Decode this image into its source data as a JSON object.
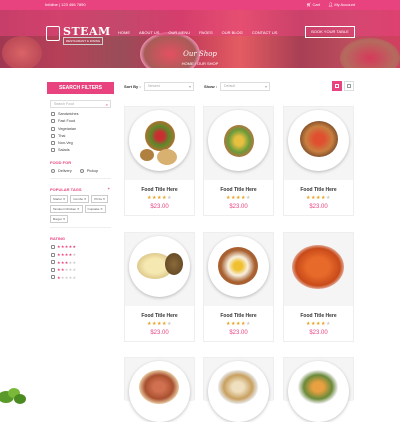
{
  "colors": {
    "accent": "#e8437e",
    "star": "#e8a020"
  },
  "topbar": {
    "phone": "Infoline | 123 456 7890",
    "cart": "Cart",
    "account": "My Account"
  },
  "brand": {
    "name": "STEAM",
    "tagline": "RESTAURANT & DINING"
  },
  "nav": [
    "HOME",
    "ABOUT US",
    "OUR MENU",
    "PAGES",
    "OUR BLOG",
    "CONTACT US"
  ],
  "book_button": "BOOK YOUR TABLE",
  "hero": {
    "title": "Our Shop",
    "crumb": "HOME  /  OUR SHOP"
  },
  "sidebar": {
    "header": "SEARCH FILTERS",
    "search_placeholder": "Search Food",
    "categories": [
      "Sandwiches",
      "Fast Food",
      "Vegetarian",
      "Thai",
      "Non-Veg",
      "Salads"
    ],
    "food_for_title": "FOOD FOR",
    "food_for": [
      "Delivery",
      "Pickup"
    ],
    "tags_title": "POPULAR TAGS",
    "tags": [
      "Starter",
      "Combo",
      "Pizza",
      "Tandoori Chicken",
      "Cupcake",
      "Burger"
    ],
    "rating_title": "RATING",
    "ratings": [
      5,
      4,
      3,
      2,
      1
    ]
  },
  "toolbar": {
    "sort_label": "Sort By :",
    "sort_value": "Newest",
    "show_label": "Show :",
    "show_value": "Default"
  },
  "products": [
    {
      "title": "Food Title Here",
      "price": "$23.00",
      "rating": 4
    },
    {
      "title": "Food Title Here",
      "price": "$23.00",
      "rating": 4
    },
    {
      "title": "Food Title Here",
      "price": "$23.00",
      "rating": 4
    },
    {
      "title": "Food Title Here",
      "price": "$23.00",
      "rating": 4
    },
    {
      "title": "Food Title Here",
      "price": "$23.00",
      "rating": 4
    },
    {
      "title": "Food Title Here",
      "price": "$23.00",
      "rating": 4
    }
  ],
  "icons": {
    "search": "search-icon",
    "cart": "cart-icon",
    "user": "user-icon",
    "grid": "grid-view-icon",
    "list": "list-view-icon"
  }
}
